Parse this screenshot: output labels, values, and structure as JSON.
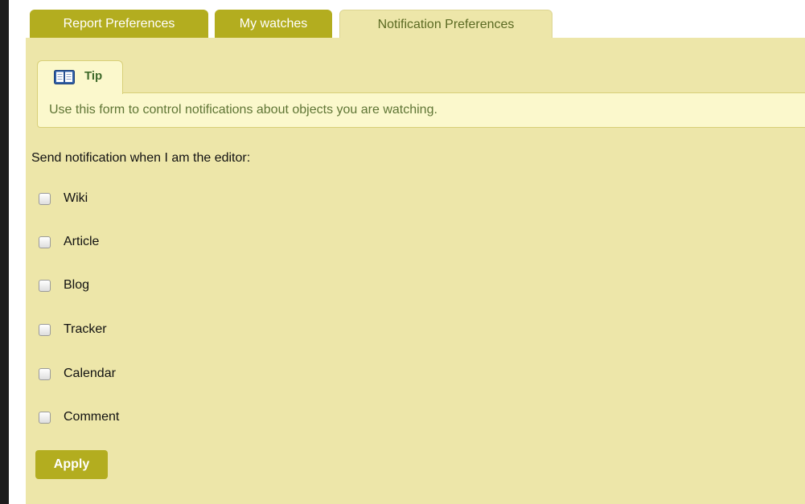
{
  "tabs": [
    {
      "label": "Report Preferences",
      "active": false
    },
    {
      "label": "My watches",
      "active": false
    },
    {
      "label": "Notification Preferences",
      "active": true
    }
  ],
  "tip": {
    "title": "Tip",
    "icon": "book-icon",
    "text": "Use this form to control notifications about objects you are watching."
  },
  "form": {
    "heading": "Send notification when I am the editor:",
    "options": [
      {
        "label": "Wiki",
        "checked": false
      },
      {
        "label": "Article",
        "checked": false
      },
      {
        "label": "Blog",
        "checked": false
      },
      {
        "label": "Tracker",
        "checked": false
      },
      {
        "label": "Calendar",
        "checked": false
      },
      {
        "label": "Comment",
        "checked": false
      }
    ],
    "apply_label": "Apply"
  },
  "colors": {
    "tab_inactive": "#b3ad1f",
    "panel_bg": "#ede6a9",
    "tip_bg": "#fbf8cc",
    "tip_text": "#5f7535",
    "button_bg": "#b3ad1f"
  }
}
